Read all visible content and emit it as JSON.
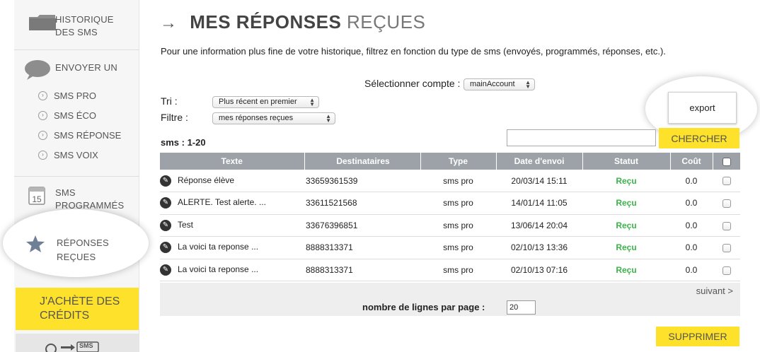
{
  "sidebar": {
    "history": {
      "line1": "HISTORIQUE",
      "line2": "DES SMS",
      "icon": "folder-icon"
    },
    "send": {
      "title": "ENVOYER UN",
      "icon": "speech-bubble-icon",
      "items": [
        {
          "label": "SMS PRO"
        },
        {
          "label": "SMS ÉCO"
        },
        {
          "label": "SMS RÉPONSE"
        },
        {
          "label": "SMS VOIX"
        }
      ]
    },
    "scheduled": {
      "line1": "SMS",
      "line2": "PROGRAMMÉS",
      "icon": "calendar-icon",
      "calendar_day": "15"
    },
    "received": {
      "line1": "RÉPONSES",
      "line2": "REÇUES",
      "icon": "star-icon"
    },
    "buy_credits": {
      "line1": "J'ACHÈTE DES",
      "line2": "CRÉDITS"
    },
    "convert_icon_text": "SMS"
  },
  "header": {
    "title_bold": "MES RÉPONSES",
    "title_light": "REÇUES"
  },
  "intro": "Pour une information plus fine de votre historique, filtrez en fonction du type de sms (envoyés, programmés, réponses, etc.).",
  "account": {
    "label": "Sélectionner compte :",
    "value": "mainAccount"
  },
  "sort": {
    "label": "Tri :",
    "value": "Plus récent en premier"
  },
  "filter": {
    "label": "Filtre :",
    "value": "mes réponses reçues"
  },
  "export_label": "export",
  "search": {
    "button": "CHERCHER",
    "placeholder": ""
  },
  "count_label": "sms : 1-20",
  "table": {
    "headers": {
      "texte": "Texte",
      "dest": "Destinataires",
      "type": "Type",
      "date": "Date d'envoi",
      "statut": "Statut",
      "cout": "Coût"
    },
    "rows": [
      {
        "texte": "Réponse élève",
        "dest": "33659361539",
        "type": "sms pro",
        "date": "20/03/14 15:11",
        "statut": "Reçu",
        "cout": "0.0"
      },
      {
        "texte": "ALERTE. Test alerte. ...",
        "dest": "33611521568",
        "type": "sms pro",
        "date": "14/01/14 11:05",
        "statut": "Reçu",
        "cout": "0.0"
      },
      {
        "texte": "Test",
        "dest": "33676396851",
        "type": "sms pro",
        "date": "13/06/14 20:04",
        "statut": "Reçu",
        "cout": "0.0"
      },
      {
        "texte": "La voici ta reponse ...",
        "dest": "8888313371",
        "type": "sms pro",
        "date": "02/10/13 13:36",
        "statut": "Reçu",
        "cout": "0.0"
      },
      {
        "texte": "La voici ta reponse ...",
        "dest": "8888313371",
        "type": "sms pro",
        "date": "02/10/13 07:16",
        "statut": "Reçu",
        "cout": "0.0"
      }
    ]
  },
  "pagination": {
    "next": "suivant >",
    "rows_label": "nombre de lignes par page :",
    "rows_value": "20"
  },
  "delete_label": "SUPPRIMER",
  "colors": {
    "accent_yellow": "#fde12a",
    "status_green": "#3cb44b",
    "table_header": "#9da2a8"
  }
}
